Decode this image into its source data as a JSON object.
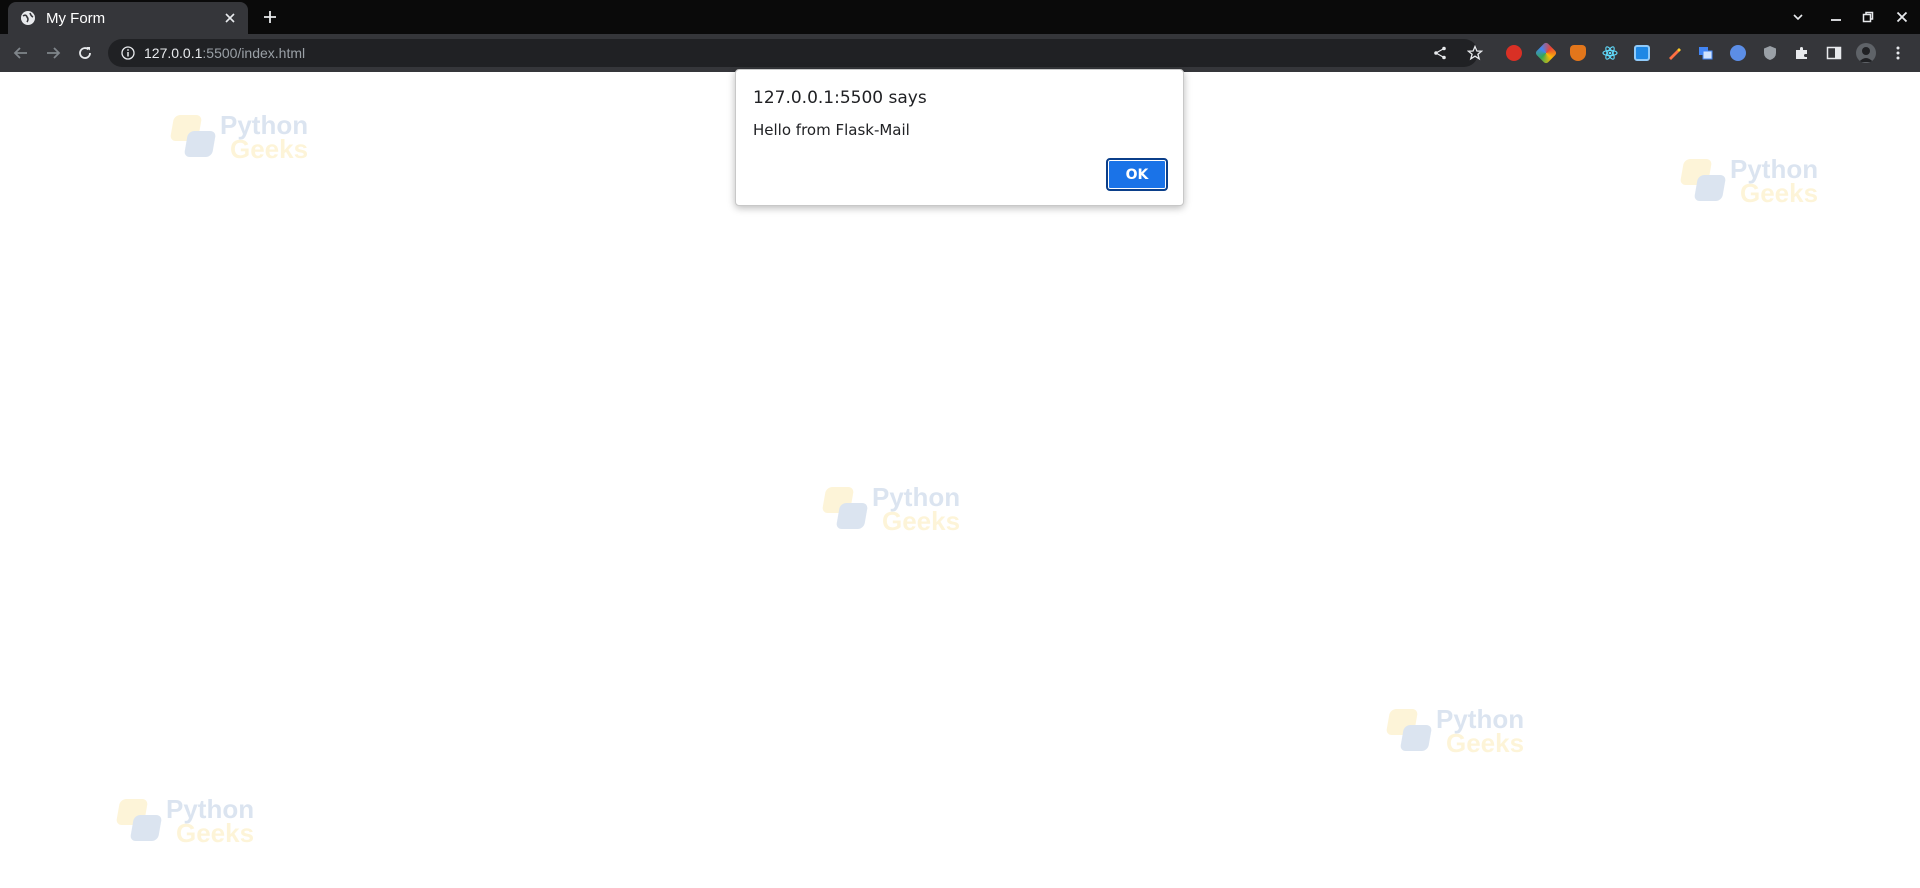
{
  "tab": {
    "title": "My Form",
    "favicon": "globe-icon",
    "close_icon": "close-icon",
    "new_tab_icon": "plus-icon"
  },
  "window_controls": [
    "tab-search-icon",
    "minimize-icon",
    "restore-icon",
    "close-window-icon"
  ],
  "toolbar": {
    "back_icon": "arrow-left-icon",
    "forward_icon": "arrow-right-icon",
    "reload_icon": "reload-icon",
    "site_info_icon": "info-icon",
    "url_host": "127.0.0.1",
    "url_rest": ":5500/index.html",
    "share_icon": "share-icon",
    "bookmark_icon": "star-icon",
    "extensions": [
      {
        "name": "red-extension-icon",
        "color": "#d93025"
      },
      {
        "name": "color-picker-extension-icon",
        "color": "#34a853"
      },
      {
        "name": "metamask-extension-icon",
        "color": "#e2761b"
      },
      {
        "name": "react-devtools-extension-icon",
        "color": "#61dafb"
      },
      {
        "name": "screenshot-extension-icon",
        "color": "#1e88e5"
      },
      {
        "name": "pen-extension-icon",
        "color": "#ff7043"
      },
      {
        "name": "tabs-extension-icon",
        "color": "#4285f4"
      },
      {
        "name": "cursor-extension-icon",
        "color": "#5c8ee6"
      },
      {
        "name": "shield-extension-icon",
        "color": "#9aa0a6"
      }
    ],
    "puzzle_icon": "puzzle-icon",
    "side_panel_icon": "side-panel-icon",
    "avatar": "avatar",
    "menu_icon": "kebab-menu-icon"
  },
  "watermark": {
    "line1": "Python",
    "line2": "Geeks"
  },
  "dialog": {
    "title": "127.0.0.1:5500 says",
    "message": "Hello from Flask-Mail",
    "ok_label": "OK"
  },
  "colors": {
    "accent": "#1a73e8",
    "tabstrip": "#0a0a0a",
    "toolbar": "#35363a",
    "omnibox": "#202124"
  }
}
